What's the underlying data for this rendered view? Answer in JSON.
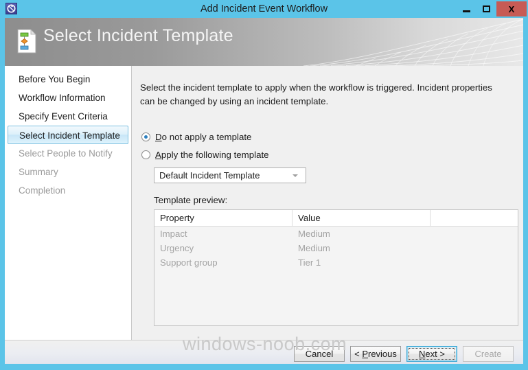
{
  "window": {
    "title": "Add Incident Event Workflow",
    "icon_name": "workflow-icon",
    "controls": {
      "minimize": "Minimize",
      "maximize": "Maximize",
      "close": "X"
    }
  },
  "banner": {
    "heading": "Select Incident Template",
    "icon_name": "incident-template-document-icon"
  },
  "sidebar": {
    "items": [
      {
        "label": "Before You Begin",
        "state": "visited"
      },
      {
        "label": "Workflow Information",
        "state": "visited"
      },
      {
        "label": "Specify Event Criteria",
        "state": "visited"
      },
      {
        "label": "Select Incident Template",
        "state": "selected"
      },
      {
        "label": "Select People to Notify",
        "state": "pending"
      },
      {
        "label": "Summary",
        "state": "pending"
      },
      {
        "label": "Completion",
        "state": "pending"
      }
    ]
  },
  "content": {
    "intro": "Select the incident template to apply when the workflow is triggered. Incident properties can be changed by using an incident template.",
    "radios": [
      {
        "label_prefix": "D",
        "label_rest": "o not apply a template",
        "selected": true
      },
      {
        "label_prefix": "A",
        "label_rest": "pply the following template",
        "selected": false
      }
    ],
    "template_combo": {
      "value": "Default Incident Template",
      "options": [
        "Default Incident Template"
      ]
    },
    "preview_label": "Template preview:",
    "preview_table": {
      "columns": [
        "Property",
        "Value",
        ""
      ],
      "rows": [
        [
          "Impact",
          "Medium",
          ""
        ],
        [
          "Urgency",
          "Medium",
          ""
        ],
        [
          "Support group",
          "Tier 1",
          ""
        ]
      ]
    }
  },
  "footer": {
    "watermark": "windows-noob.com",
    "buttons": [
      {
        "label": "Cancel",
        "state": "normal",
        "access_key": ""
      },
      {
        "label": "< Previous",
        "state": "normal",
        "access_key": "P"
      },
      {
        "label": "Next >",
        "state": "focused",
        "access_key": "N"
      },
      {
        "label": "Create",
        "state": "disabled",
        "access_key": ""
      }
    ]
  },
  "colors": {
    "window_frame": "#5bc4e8",
    "close_button": "#c75b55",
    "selection_blue": "#7cc0e0",
    "radio_dot": "#2c7fbf",
    "disabled_text": "#a3a3a3"
  }
}
